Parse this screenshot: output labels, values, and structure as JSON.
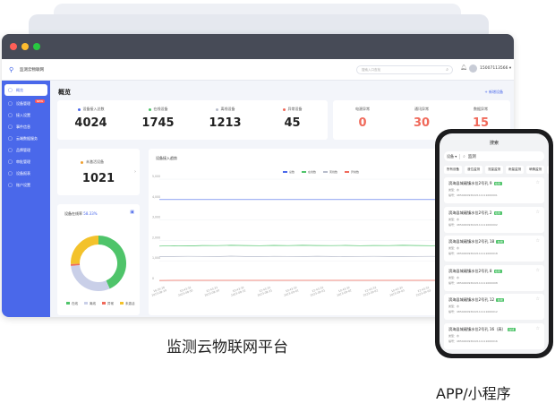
{
  "window": {
    "colors": {
      "close": "#ff5f57",
      "minimize": "#febc2e",
      "maximize": "#28c840",
      "accent": "#4a68ea"
    },
    "app_name": "监测云物联网",
    "search_placeholder": "搜索入口查找",
    "user": "15007113566 ▾"
  },
  "sidebar": {
    "items": [
      {
        "label": "概览",
        "icon": "monitor-icon",
        "active": true
      },
      {
        "label": "设备管理",
        "icon": "device-icon",
        "badge": "NEW"
      },
      {
        "label": "接入设置",
        "icon": "plug-icon"
      },
      {
        "label": "事件信息",
        "icon": "event-icon"
      },
      {
        "label": "云端数据服务",
        "icon": "cloud-icon"
      },
      {
        "label": "品牌管理",
        "icon": "brand-icon"
      },
      {
        "label": "审批管理",
        "icon": "approval-icon"
      },
      {
        "label": "设备报表",
        "icon": "report-icon"
      },
      {
        "label": "账户设置",
        "icon": "account-icon"
      }
    ]
  },
  "overview": {
    "title": "概览",
    "add_device": "+ 新增设备",
    "stats": [
      {
        "label": "设备接入总数",
        "value": "4024",
        "dot": "#4a68ea"
      },
      {
        "label": "在线设备",
        "value": "1745",
        "dot": "#4fc46a"
      },
      {
        "label": "离线设备",
        "value": "1213",
        "dot": "#b7bccb"
      },
      {
        "label": "异常设备",
        "value": "45",
        "dot": "#f06a5b"
      }
    ],
    "alarms": [
      {
        "label": "电源异常",
        "value": "0"
      },
      {
        "label": "通讯异常",
        "value": "30"
      },
      {
        "label": "数据异常",
        "value": "15"
      }
    ],
    "unactivated": {
      "label": "未激活设备",
      "value": "1021"
    },
    "online_ratio": {
      "label": "设备在线率",
      "value": "58.33%"
    },
    "donut_legend": [
      "在线",
      "离线",
      "异常",
      "未激活"
    ]
  },
  "chart_data": {
    "type": "line",
    "title": "设备接入趋势",
    "series": [
      {
        "name": "总数",
        "color": "#4a68ea",
        "values": [
          4000,
          4000,
          4000,
          4000,
          4000,
          4000,
          4000,
          4000,
          4000,
          4000,
          4000,
          4000,
          4000,
          4000,
          4000,
          4000,
          4000,
          4000,
          4000,
          4000,
          4000,
          4000,
          4000,
          4000,
          4000
        ]
      },
      {
        "name": "在线数",
        "color": "#4fc46a",
        "values": [
          1720,
          1740,
          1730,
          1750,
          1745,
          1760,
          1750,
          1740,
          1755,
          1745,
          1760,
          1750,
          1745,
          1755,
          1740,
          1750,
          1745,
          1760,
          1750,
          1740,
          1755,
          1745,
          1750,
          1745,
          1745
        ]
      },
      {
        "name": "离线数",
        "color": "#b7bccb",
        "values": [
          1200,
          1210,
          1220,
          1215,
          1205,
          1230,
          1210,
          1200,
          1220,
          1215,
          1205,
          1225,
          1210,
          1200,
          1215,
          1220,
          1210,
          1205,
          1215,
          1220,
          1210,
          1215,
          1205,
          1210,
          1213
        ]
      },
      {
        "name": "异常数",
        "color": "#f06a5b",
        "values": [
          40,
          42,
          45,
          44,
          43,
          46,
          45,
          44,
          45,
          43,
          44,
          46,
          45,
          44,
          45,
          43,
          45,
          44,
          46,
          45,
          44,
          45,
          44,
          45,
          45
        ]
      }
    ],
    "yticks": [
      "5,000",
      "4,000",
      "3,000",
      "2,000",
      "1,000",
      "0"
    ],
    "ylim": [
      0,
      5000
    ],
    "xticks": [
      "16:35:26\n2023-08-29",
      "10:43:32\n2023-08-30",
      "22:43:32\n2023-08-30",
      "10:43:32\n2023-08-31",
      "22:43:32\n2023-08-31",
      "10:43:32\n2023-09-01",
      "22:43:32\n2023-09-01",
      "10:43:32\n2023-09-02",
      "22:43:32\n2023-09-02",
      "10:43:32\n2023-09-03",
      "22:43:32\n2023-09-03",
      "10:43:32\n2023-09-04",
      "22:43:32\n2023-09-04",
      "10:43:32\n2023-09-05"
    ],
    "donut": {
      "online": 1745,
      "offline": 1213,
      "abnormal": 45,
      "unactivated": 1021
    }
  },
  "phone": {
    "title": "搜索",
    "select": "设备 ▾",
    "query": "监测",
    "tabs": [
      "所有设备",
      "水质监测",
      "流量监测",
      "雨情监测",
      "动态环境",
      "地震"
    ],
    "tab_texts": [
      "所有设备",
      "液位监测",
      "流量监测",
      "雨量监测",
      "墒情监测",
      "地震"
    ],
    "items": [
      {
        "name": "滨海县城厢镇水位2号孔 9",
        "tag": "在线",
        "type": "类型：水",
        "code": "编号：485400093022111111000001"
      },
      {
        "name": "滨海县城厢镇水位2号孔 2",
        "tag": "在线",
        "type": "类型：水",
        "code": "编号：485400093022111111000002"
      },
      {
        "name": "滨海县城厢镇水位2号孔 18",
        "tag": "在线",
        "type": "类型：水",
        "code": "编号：485400093022111111000018"
      },
      {
        "name": "滨海县城厢镇水位2号孔 8",
        "tag": "在线",
        "type": "类型：水",
        "code": "编号：485400093022111111000008"
      },
      {
        "name": "滨海县城厢镇水位2号孔 12",
        "tag": "在线",
        "type": "类型：水",
        "code": "编号：485400093022111111000012"
      },
      {
        "name": "滨海县城厢镇水位2号孔 16（高）",
        "tag": "在线",
        "type": "类型：水",
        "code": "编号：485400093022111111000016"
      }
    ]
  },
  "captions": {
    "desktop": "监测云物联网平台",
    "mobile": "APP/小程序"
  }
}
